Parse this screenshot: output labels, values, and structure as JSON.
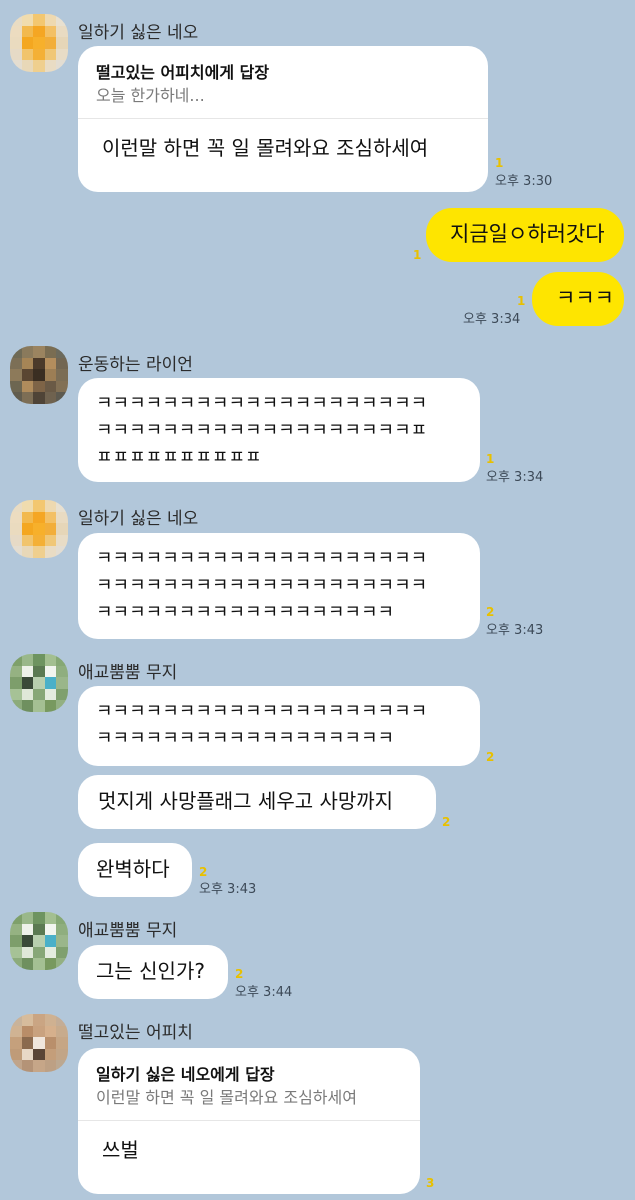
{
  "colors": {
    "background": "#b2c7da",
    "my_bubble": "#fee500",
    "other_bubble": "#ffffff",
    "unread": "#e8c000"
  },
  "messages": {
    "m1": {
      "sender": "일하기 싫은 네오",
      "reply_title": "떨고있는 어피치에게 답장",
      "reply_quote": "오늘 한가하네...",
      "text": "이런말 하면 꼭 일 몰려와요 조심하세여",
      "unread": "1",
      "time": "오후 3:30"
    },
    "m2": {
      "text": "지금일ㅇ하러갓다",
      "unread": "1"
    },
    "m3": {
      "text": "ㅋㅋㅋ",
      "unread": "1",
      "time": "오후 3:34"
    },
    "m4": {
      "sender": "운동하는 라이언",
      "lines": [
        "ㅋㅋㅋㅋㅋㅋㅋㅋㅋㅋㅋㅋㅋㅋㅋㅋㅋㅋㅋㅋ",
        "ㅋㅋㅋㅋㅋㅋㅋㅋㅋㅋㅋㅋㅋㅋㅋㅋㅋㅋㅋㅍ",
        "ㅍㅍㅍㅍㅍㅍㅍㅍㅍㅍ"
      ],
      "unread": "1",
      "time": "오후 3:34"
    },
    "m5": {
      "sender": "일하기 싫은 네오",
      "lines": [
        "ㅋㅋㅋㅋㅋㅋㅋㅋㅋㅋㅋㅋㅋㅋㅋㅋㅋㅋㅋㅋ",
        "ㅋㅋㅋㅋㅋㅋㅋㅋㅋㅋㅋㅋㅋㅋㅋㅋㅋㅋㅋㅋ",
        "ㅋㅋㅋㅋㅋㅋㅋㅋㅋㅋㅋㅋㅋㅋㅋㅋㅋㅋ"
      ],
      "unread": "2",
      "time": "오후 3:43"
    },
    "m6": {
      "sender": "애교뿜뿜 무지",
      "lines": [
        "ㅋㅋㅋㅋㅋㅋㅋㅋㅋㅋㅋㅋㅋㅋㅋㅋㅋㅋㅋㅋ",
        "ㅋㅋㅋㅋㅋㅋㅋㅋㅋㅋㅋㅋㅋㅋㅋㅋㅋㅋ"
      ],
      "unread": "2"
    },
    "m7": {
      "text": "멋지게 사망플래그 세우고 사망까지",
      "unread": "2"
    },
    "m8": {
      "text": "완벽하다",
      "unread": "2",
      "time": "오후 3:43"
    },
    "m9": {
      "sender": "애교뿜뿜 무지",
      "text": "그는 신인가?",
      "unread": "2",
      "time": "오후 3:44"
    },
    "m10": {
      "sender": "떨고있는 어피치",
      "reply_title": "일하기 싫은 네오에게 답장",
      "reply_quote": "이런말 하면 꼭 일 몰려와요 조심하세여",
      "text": "쓰벌",
      "unread": "3"
    }
  }
}
